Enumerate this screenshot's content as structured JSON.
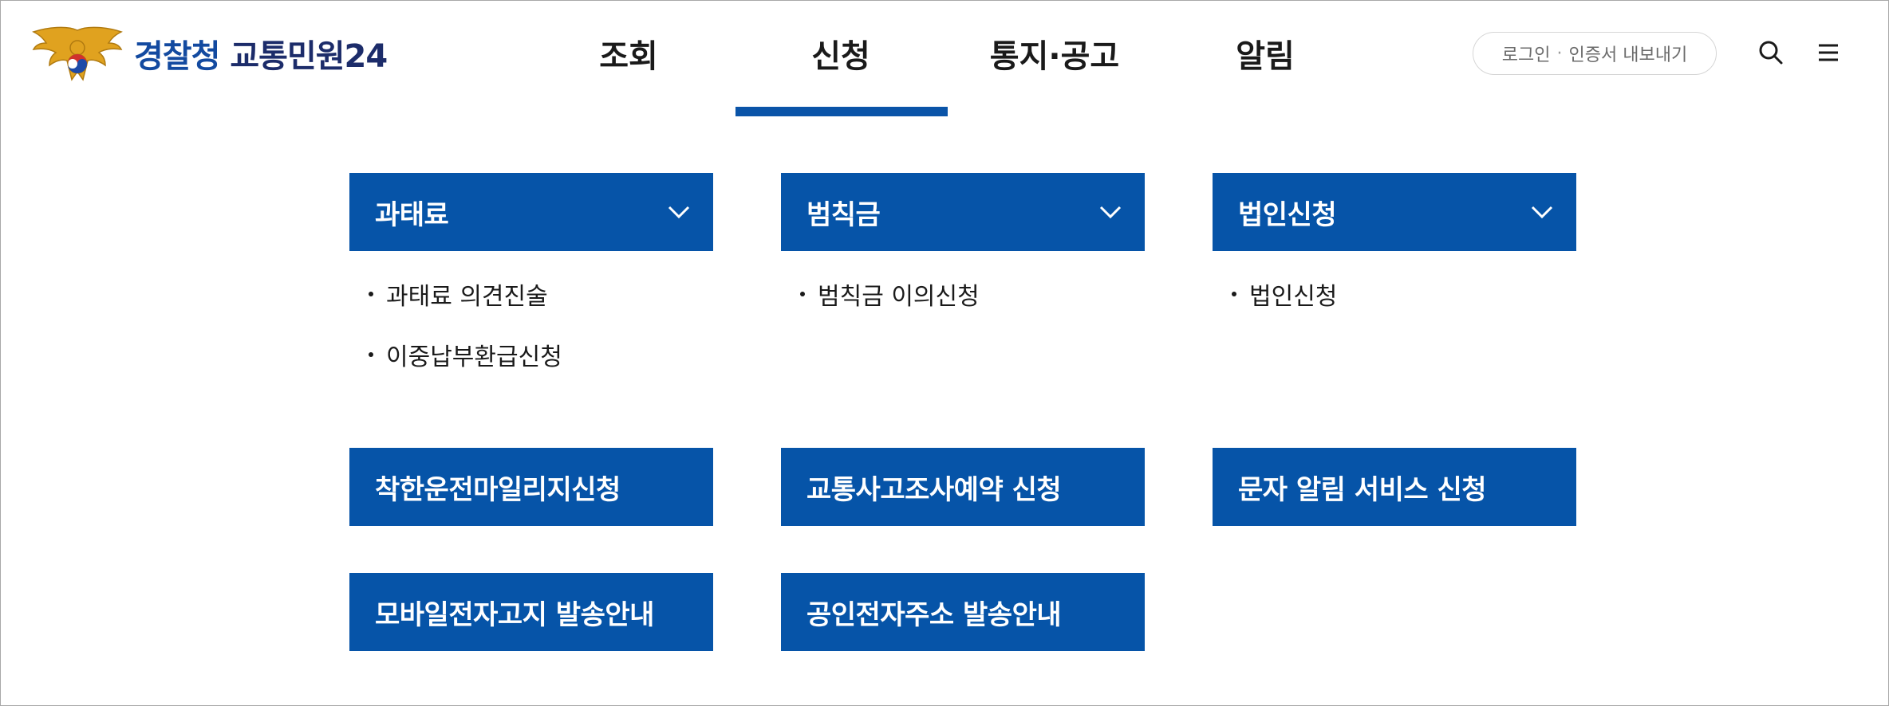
{
  "header": {
    "logo_text_part1": "경찰청",
    "logo_text_part2": "교통민원24",
    "nav": [
      {
        "label": "조회",
        "active": false
      },
      {
        "label": "신청",
        "active": true
      },
      {
        "label": "통지·공고",
        "active": false
      },
      {
        "label": "알림",
        "active": false
      }
    ],
    "login_label": "로그인",
    "login_separator": "·",
    "cert_export_label": "인증서 내보내기",
    "search_icon": "search-icon",
    "menu_icon": "hamburger-menu-icon"
  },
  "colors": {
    "primary": "#0654a8",
    "nav_underline": "#0a54a8",
    "logo_blue": "#134aa0"
  },
  "menu_groups": [
    {
      "title": "과태료",
      "icon": "chevron-down-icon",
      "items": [
        "과태료 의견진술",
        "이중납부환급신청"
      ]
    },
    {
      "title": "범칙금",
      "icon": "chevron-down-icon",
      "items": [
        "범칙금 이의신청"
      ]
    },
    {
      "title": "법인신청",
      "icon": "chevron-down-icon",
      "items": [
        "법인신청"
      ]
    }
  ],
  "single_links": [
    "착한운전마일리지신청",
    "교통사고조사예약 신청",
    "문자 알림 서비스 신청",
    "모바일전자고지 발송안내",
    "공인전자주소 발송안내"
  ]
}
